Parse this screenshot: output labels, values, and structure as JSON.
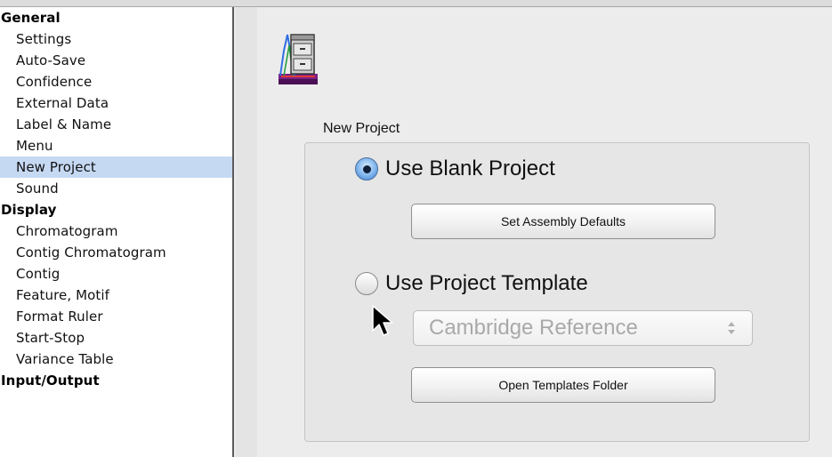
{
  "sidebar": {
    "sections": [
      {
        "heading": "General",
        "items": [
          "Settings",
          "Auto-Save",
          "Confidence",
          "External Data",
          "Label & Name",
          "Menu",
          "New Project",
          "Sound"
        ]
      },
      {
        "heading": "Display",
        "items": [
          "Chromatogram",
          "Contig Chromatogram",
          "Contig",
          "Feature, Motif",
          "Format Ruler",
          "Start-Stop",
          "Variance Table"
        ]
      },
      {
        "heading": "Input/Output",
        "items": []
      }
    ],
    "selected": "New Project"
  },
  "main": {
    "icon": "project-cabinet-icon",
    "group_label": "New Project",
    "option_blank": {
      "label": "Use Blank Project",
      "selected": true
    },
    "set_defaults_button": "Set Assembly Defaults",
    "option_template": {
      "label": "Use Project Template",
      "selected": false
    },
    "template_popup": {
      "value": "Cambridge Reference",
      "enabled": false
    },
    "open_templates_button": "Open Templates Folder"
  },
  "colors": {
    "selection": "#c6d9f3",
    "radio_selected": "#5b9ae0",
    "window_bg": "#ececec"
  }
}
